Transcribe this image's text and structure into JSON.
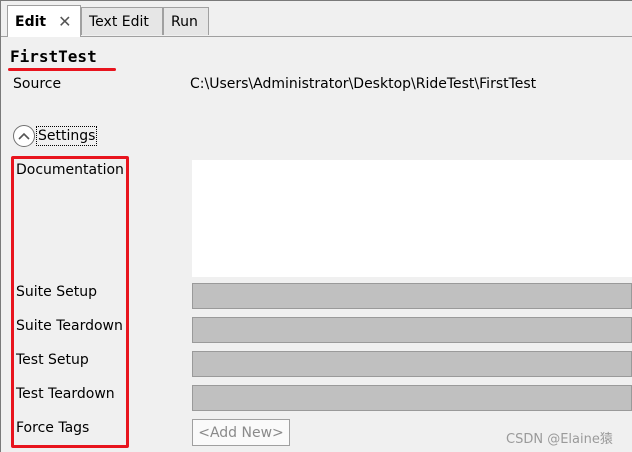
{
  "tabs": [
    {
      "label": "Edit",
      "active": true,
      "closable": true
    },
    {
      "label": "Text Edit",
      "active": false,
      "closable": false
    },
    {
      "label": "Run",
      "active": false,
      "closable": false
    }
  ],
  "suite": {
    "name": "FirstTest",
    "source_label": "Source",
    "source_value": "C:\\Users\\Administrator\\Desktop\\RideTest\\FirstTest"
  },
  "settings": {
    "label": "Settings",
    "expanded": true,
    "fields": {
      "documentation": "Documentation",
      "suite_setup": "Suite Setup",
      "suite_teardown": "Suite Teardown",
      "test_setup": "Test Setup",
      "test_teardown": "Test Teardown",
      "force_tags": "Force Tags"
    },
    "add_new_label": "<Add New>"
  },
  "watermark": "CSDN @Elaine猿",
  "colors": {
    "annotation_red": "#e8141e",
    "field_gray": "#c0c0c0",
    "panel_bg": "#f0f0f0"
  }
}
